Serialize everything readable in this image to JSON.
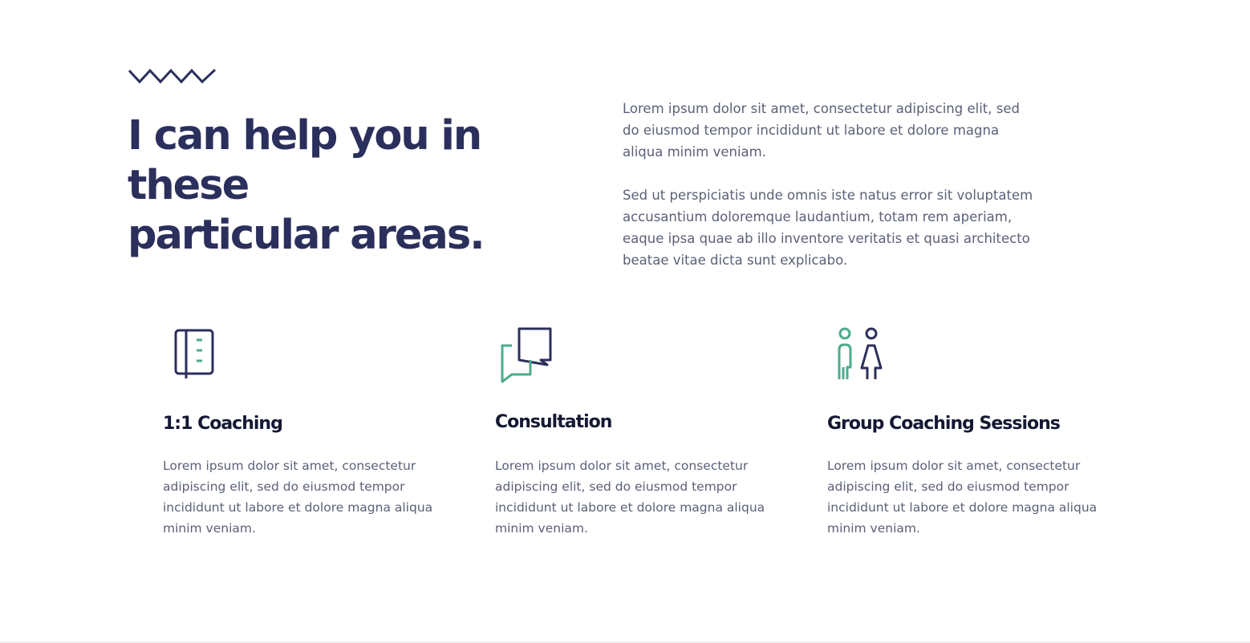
{
  "colors": {
    "navy": "#2b2f5c",
    "heading": "#141833",
    "body_text": "#5c6078",
    "accent_green": "#4daa8e"
  },
  "header": {
    "decoration_icon": "zigzag-icon",
    "headline_line1": "I can help you in these",
    "headline_line2": "particular areas.",
    "intro_paragraph_1": "Lorem ipsum dolor sit amet, consectetur adipiscing elit, sed do eiusmod tempor incididunt ut labore et dolore magna aliqua minim veniam.",
    "intro_paragraph_2": "Sed ut perspiciatis unde omnis iste natus error sit voluptatem accusantium doloremque laudantium, totam rem aperiam, eaque ipsa quae ab illo inventore veritatis et quasi architecto beatae vitae dicta sunt explicabo."
  },
  "services": [
    {
      "icon": "notebook-icon",
      "title": "1:1 Coaching",
      "description": "Lorem ipsum dolor sit amet, consectetur adipiscing elit, sed do eiusmod tempor incididunt ut labore et dolore magna aliqua minim veniam."
    },
    {
      "icon": "chat-bubbles-icon",
      "title": "Consultation",
      "description": "Lorem ipsum dolor sit amet, consectetur adipiscing elit, sed do eiusmod tempor incididunt ut labore et dolore magna aliqua minim veniam."
    },
    {
      "icon": "people-icon",
      "title": "Group Coaching Sessions",
      "description": "Lorem ipsum dolor sit amet, consectetur adipiscing elit, sed do eiusmod tempor incididunt ut labore et dolore magna aliqua minim veniam."
    }
  ]
}
